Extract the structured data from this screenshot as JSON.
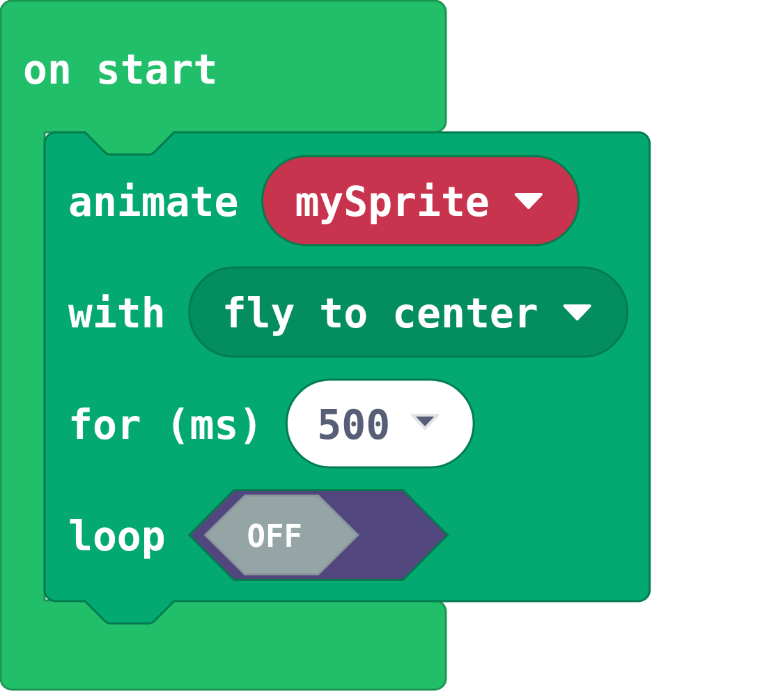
{
  "event_block": {
    "label": "on start"
  },
  "statement": {
    "rows": [
      {
        "kind": "dropdown",
        "label": "animate",
        "value": "mySprite",
        "color": "#c8334e"
      },
      {
        "kind": "dropdown",
        "label": "with",
        "value": "fly to center",
        "color": "#048d5e"
      },
      {
        "kind": "number",
        "label": "for (ms)",
        "value": "500"
      },
      {
        "kind": "toggle",
        "label": "loop",
        "on": false,
        "text": "OFF"
      }
    ]
  }
}
